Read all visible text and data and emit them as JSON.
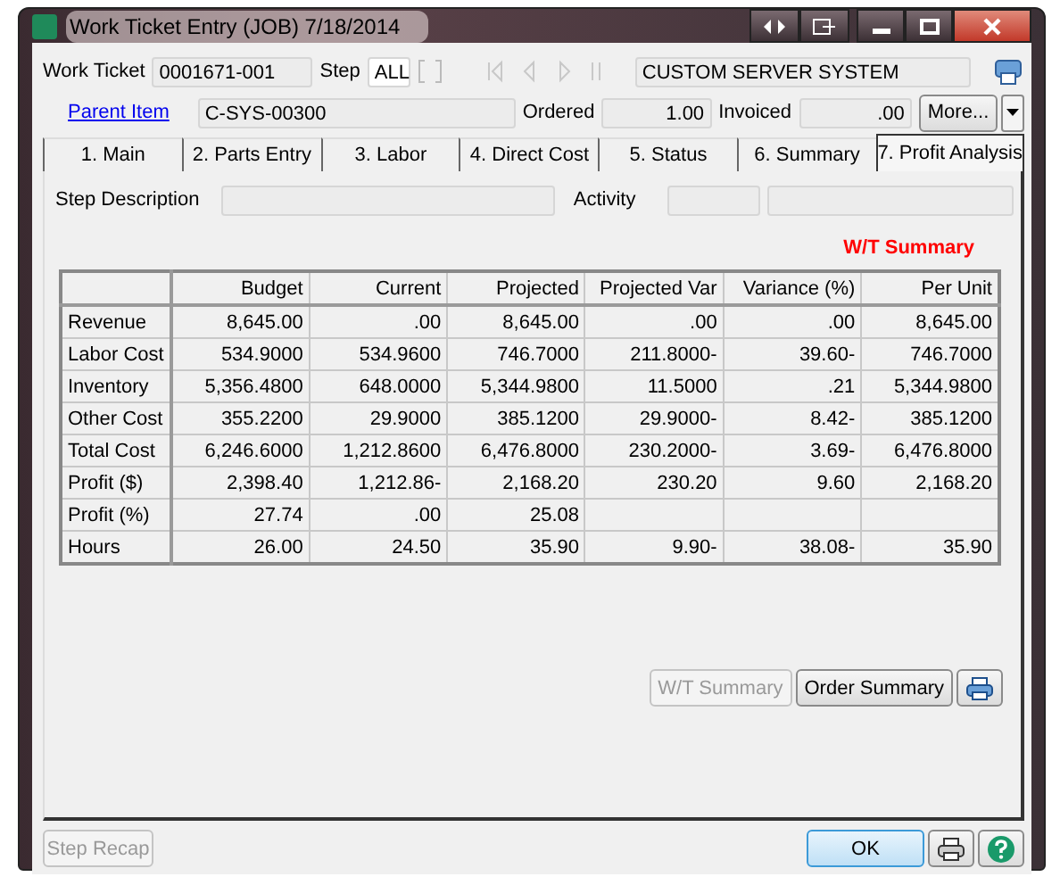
{
  "window": {
    "title": "Work Ticket Entry (JOB) 7/18/2014"
  },
  "header": {
    "work_ticket_label": "Work Ticket",
    "work_ticket": "0001671-001",
    "step_label": "Step",
    "step": "ALL",
    "description": "CUSTOM SERVER SYSTEM",
    "parent_item_link": "Parent Item",
    "parent_item": "C-SYS-00300",
    "ordered_label": "Ordered",
    "ordered": "1.00",
    "invoiced_label": "Invoiced",
    "invoiced": ".00",
    "more_button": "More..."
  },
  "tabs": [
    {
      "label": "1. Main",
      "selected": false
    },
    {
      "label": "2. Parts Entry",
      "selected": false
    },
    {
      "label": "3. Labor",
      "selected": false
    },
    {
      "label": "4. Direct Cost",
      "selected": false
    },
    {
      "label": "5. Status",
      "selected": false
    },
    {
      "label": "6. Summary",
      "selected": false
    },
    {
      "label": "7. Profit Analysis",
      "selected": true
    }
  ],
  "step_row": {
    "step_description_label": "Step Description",
    "activity_label": "Activity"
  },
  "summary_title": "W/T Summary",
  "table": {
    "columns": [
      "Budget",
      "Current",
      "Projected",
      "Projected Var",
      "Variance (%)",
      "Per Unit"
    ],
    "rows": [
      {
        "label": "Revenue",
        "cells": [
          "8,645.00",
          ".00",
          "8,645.00",
          ".00",
          ".00",
          "8,645.00"
        ]
      },
      {
        "label": "Labor Cost",
        "cells": [
          "534.9000",
          "534.9600",
          "746.7000",
          "211.8000-",
          "39.60-",
          "746.7000"
        ]
      },
      {
        "label": "Inventory",
        "cells": [
          "5,356.4800",
          "648.0000",
          "5,344.9800",
          "11.5000",
          ".21",
          "5,344.9800"
        ]
      },
      {
        "label": "Other Cost",
        "cells": [
          "355.2200",
          "29.9000",
          "385.1200",
          "29.9000-",
          "8.42-",
          "385.1200"
        ]
      },
      {
        "label": "Total Cost",
        "cells": [
          "6,246.6000",
          "1,212.8600",
          "6,476.8000",
          "230.2000-",
          "3.69-",
          "6,476.8000"
        ]
      },
      {
        "label": "Profit ($)",
        "cells": [
          "2,398.40",
          "1,212.86-",
          "2,168.20",
          "230.20",
          "9.60",
          "2,168.20"
        ]
      },
      {
        "label": "Profit (%)",
        "cells": [
          "27.74",
          ".00",
          "25.08",
          null,
          null,
          null
        ]
      },
      {
        "label": "Hours",
        "cells": [
          "26.00",
          "24.50",
          "35.90",
          "9.90-",
          "38.08-",
          "35.90"
        ]
      }
    ]
  },
  "summary_buttons": [
    {
      "label": "W/T Summary",
      "disabled": true
    },
    {
      "label": "Order Summary",
      "disabled": false
    }
  ],
  "footer": {
    "step_recap": {
      "label": "Step Recap",
      "disabled": true
    },
    "ok": "OK"
  }
}
